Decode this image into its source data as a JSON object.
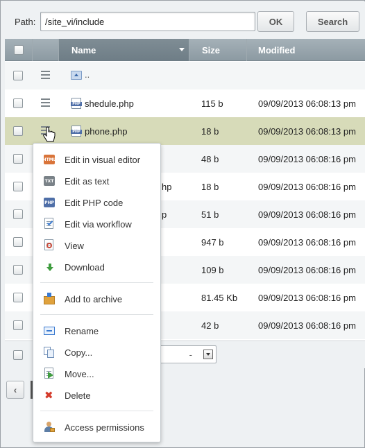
{
  "toolbar": {
    "path_label": "Path:",
    "path_value": "/site_vi/include",
    "ok_label": "OK",
    "search_label": "Search"
  },
  "grid": {
    "columns": {
      "name": "Name",
      "size": "Size",
      "modified": "Modified"
    },
    "up_label": "..",
    "rows": [
      {
        "name": "shedule.php",
        "size": "115 b",
        "modified": "09/09/2013 06:08:13 pm"
      },
      {
        "name": "phone.php",
        "size": "18 b",
        "modified": "09/09/2013 06:08:13 pm"
      },
      {
        "name": "",
        "size": "48 b",
        "modified": "09/09/2013 06:08:16 pm"
      },
      {
        "name": "hp",
        "size": "18 b",
        "modified": "09/09/2013 06:08:16 pm"
      },
      {
        "name": "p",
        "size": "51 b",
        "modified": "09/09/2013 06:08:16 pm"
      },
      {
        "name": "",
        "size": "947 b",
        "modified": "09/09/2013 06:08:16 pm"
      },
      {
        "name": "",
        "size": "109 b",
        "modified": "09/09/2013 06:08:16 pm"
      },
      {
        "name": "",
        "size": "81.45 Kb",
        "modified": "09/09/2013 06:08:16 pm"
      },
      {
        "name": "",
        "size": "42 b",
        "modified": "09/09/2013 06:08:16 pm"
      }
    ],
    "footer_select_value": "-"
  },
  "pager": {
    "prev_label": "‹"
  },
  "context_menu": {
    "items": [
      {
        "label": "Edit in visual editor",
        "icon": "html-edit-icon"
      },
      {
        "label": "Edit as text",
        "icon": "text-edit-icon"
      },
      {
        "label": "Edit PHP code",
        "icon": "php-edit-icon"
      },
      {
        "label": "Edit via workflow",
        "icon": "workflow-icon"
      },
      {
        "label": "View",
        "icon": "view-icon"
      },
      {
        "label": "Download",
        "icon": "download-icon"
      },
      {
        "label": "Add to archive",
        "icon": "archive-icon"
      },
      {
        "label": "Rename",
        "icon": "rename-icon"
      },
      {
        "label": "Copy...",
        "icon": "copy-icon"
      },
      {
        "label": "Move...",
        "icon": "move-icon"
      },
      {
        "label": "Delete",
        "icon": "delete-icon"
      },
      {
        "label": "Access permissions",
        "icon": "permissions-icon"
      }
    ]
  },
  "icon_text": {
    "html": "HTML",
    "txt": "TXT",
    "php": "PHP"
  },
  "colors": {
    "header_bg": "#98a6ad",
    "selected_row": "#d7dbb9",
    "delete_red": "#d43a2a"
  }
}
